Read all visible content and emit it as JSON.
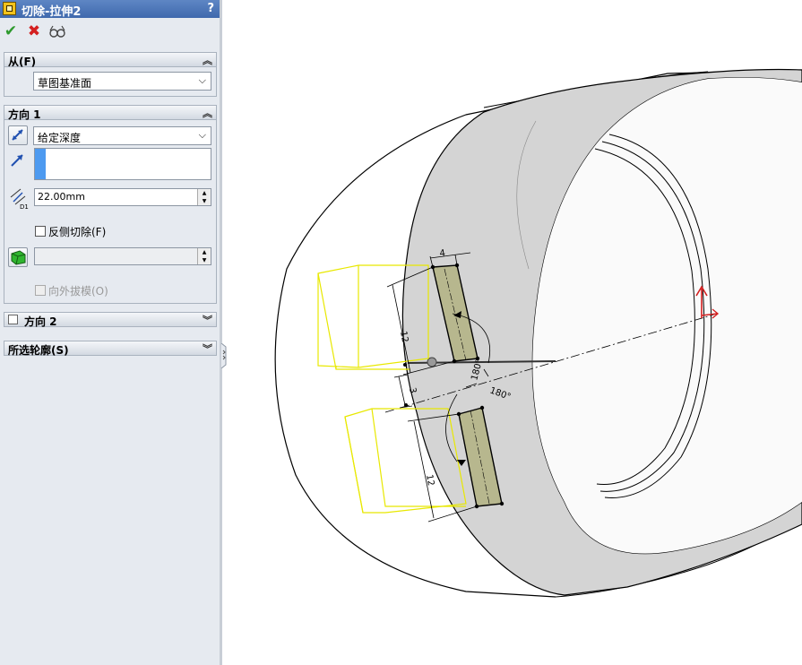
{
  "window": {
    "title": "切除-拉伸2",
    "help": "?"
  },
  "actions": {
    "ok": "✔",
    "cancel": "✖",
    "preview": "66"
  },
  "from": {
    "header": "从(F)",
    "value": "草图基准面"
  },
  "direction1": {
    "header": "方向 1",
    "end_condition": "给定深度",
    "depth": "22.00mm",
    "flip_side_label": "反侧切除(F)",
    "draft_outward_label": "向外拔模(O)"
  },
  "direction2": {
    "header": "方向 2"
  },
  "contours": {
    "header": "所选轮廓(S)"
  },
  "dimensions": {
    "d_width": "4",
    "d_len_top": "12",
    "d_gap": "3",
    "d_len_bottom": "12",
    "d_angle1": "180°",
    "d_angle2": "180°"
  },
  "colors": {
    "title_bar": "#4a74b6",
    "panel_bg": "#e6eaf0",
    "ok_green": "#2e9a2e",
    "cancel_red": "#d42020",
    "slot_fill": "#b7b78e",
    "preview_yellow": "#e8e800",
    "shell_gray": "#d4d4d4"
  }
}
